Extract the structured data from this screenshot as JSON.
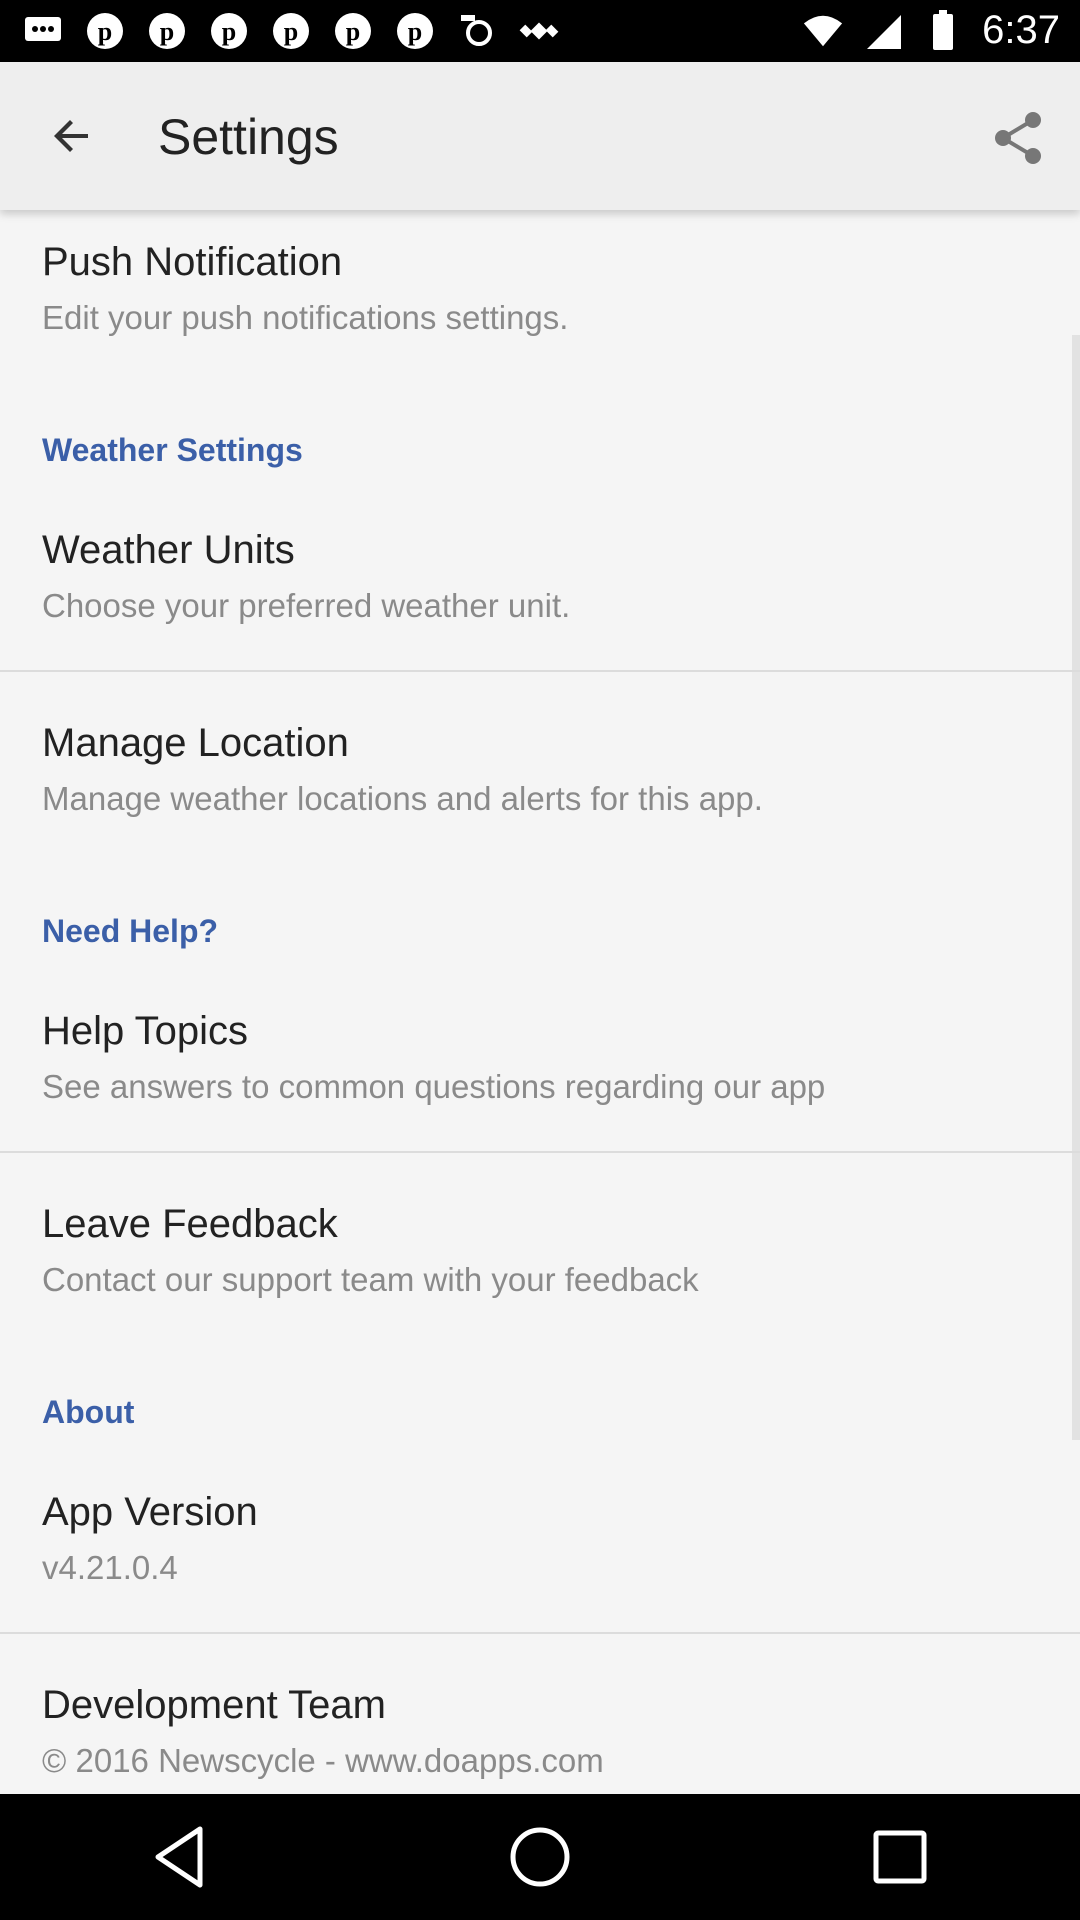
{
  "status_bar": {
    "time": "6:37",
    "left_icons": [
      "messages-icon",
      "pinterest-icon",
      "pinterest-icon",
      "pinterest-icon",
      "pinterest-icon",
      "pinterest-icon",
      "pinterest-icon",
      "fake-gps-icon",
      "satellite-icon"
    ],
    "right_icons": [
      "wifi-icon",
      "signal-icon",
      "battery-icon"
    ]
  },
  "appbar": {
    "title": "Settings",
    "back_icon": "arrow-back-icon",
    "share_icon": "share-icon"
  },
  "sections": {
    "push": {
      "title": "Push Notification",
      "subtitle": "Edit your push notifications settings."
    },
    "weather_header": "Weather Settings",
    "weather_units": {
      "title": "Weather Units",
      "subtitle": "Choose your preferred weather unit."
    },
    "manage_location": {
      "title": "Manage Location",
      "subtitle": "Manage weather locations and alerts for this app."
    },
    "help_header": "Need Help?",
    "help_topics": {
      "title": "Help Topics",
      "subtitle": "See answers to common questions regarding our app"
    },
    "leave_feedback": {
      "title": "Leave Feedback",
      "subtitle": "Contact our support team with your feedback"
    },
    "about_header": "About",
    "app_version": {
      "title": "App Version",
      "subtitle": "v4.21.0.4"
    },
    "dev_team": {
      "title": "Development Team",
      "subtitle": "© 2016 Newscycle - www.doapps.com"
    }
  },
  "colors": {
    "accent": "#3b5fa8",
    "appbar_bg": "#eeeeee",
    "page_bg": "#f5f5f5"
  },
  "nav_bar": {
    "icons": [
      "back-triangle-icon",
      "home-circle-icon",
      "recents-square-icon"
    ]
  }
}
